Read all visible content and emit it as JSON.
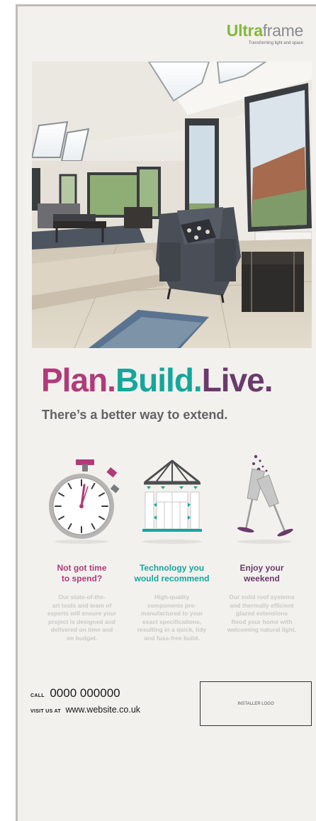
{
  "brand": {
    "bold": "Ultra",
    "light": "frame",
    "tagline": "Transforming light and space"
  },
  "headline": {
    "plan": "Plan.",
    "build": "Build.",
    "live": "Live."
  },
  "subheadline": "There’s a better way to extend.",
  "features": [
    {
      "icon": "stopwatch-icon",
      "title_line1": "Not got time",
      "title_line2": "to spend?",
      "body": [
        "Our state-of-the-",
        "art tools and team of",
        "experts will ensure your",
        "project is designed and",
        "delivered on time and",
        "on budget."
      ],
      "color": "#b13b79"
    },
    {
      "icon": "conservatory-icon",
      "title_line1": "Technology you",
      "title_line2": "would recommend",
      "body": [
        "High-quality",
        "components pre-",
        "manufactured to your",
        "exact specifications,",
        "resulting in a quick, tidy",
        "and fuss-free build."
      ],
      "color": "#14a79b"
    },
    {
      "icon": "champagne-glasses-icon",
      "title_line1": "Enjoy your",
      "title_line2": "weekend",
      "body": [
        "Our solid roof systems",
        "and thermally efficient",
        "glazed extensions",
        "flood your home with",
        "welcoming natural light."
      ],
      "color": "#6b3a6b"
    }
  ],
  "contact": {
    "call_label": "Call",
    "phone": "0000 000000",
    "visit_label": "Visit us at",
    "website": "www.website.co.uk"
  },
  "installer_logo_text": "INSTALLER LOGO"
}
